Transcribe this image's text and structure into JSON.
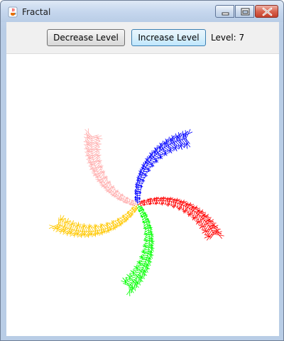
{
  "window": {
    "title": "Fractal",
    "controls": [
      "minimize",
      "maximize",
      "close"
    ],
    "app_icon": "java-cup-icon"
  },
  "toolbar": {
    "decrease_label": "Decrease Level",
    "increase_label": "Increase Level",
    "level_prefix": "Level:",
    "level_value": 7,
    "level_text": "Level: 7"
  },
  "fractal": {
    "level": 7,
    "arms": [
      {
        "name": "blue",
        "color": "#0000ff"
      },
      {
        "name": "red",
        "color": "#ff0000"
      },
      {
        "name": "green",
        "color": "#00ff00"
      },
      {
        "name": "yellow",
        "color": "#ffc800"
      },
      {
        "name": "pink",
        "color": "#ffafaf"
      }
    ]
  }
}
